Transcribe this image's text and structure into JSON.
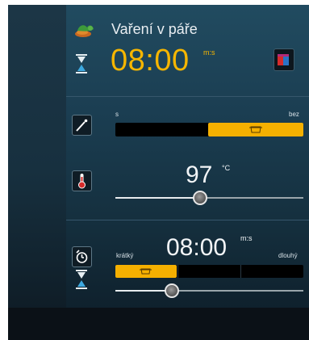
{
  "program": {
    "title": "Vaření v páře",
    "time": "08:00",
    "time_unit": "m:s"
  },
  "intensity": {
    "left_label": "s",
    "right_label": "bez",
    "selected_index": 1,
    "segment_count": 2
  },
  "temperature": {
    "value": "97",
    "unit": "°C",
    "slider_level": 0.45
  },
  "duration": {
    "value": "08:00",
    "unit": "m:s",
    "left_label": "krátký",
    "right_label": "dlouhý",
    "selected_index": 0,
    "segment_count": 3,
    "slider_level": 0.3
  },
  "icons": {
    "program": "vegetables-icon",
    "timer": "hourglass-icon",
    "favorite": "colored-tiles-icon",
    "wand": "magic-wand-icon",
    "thermometer": "thermometer-icon",
    "delay": "timer-clock-icon",
    "duration": "hourglass-icon",
    "pot": "pot-icon"
  },
  "colors": {
    "accent": "#f5b000",
    "panel": "#1b3e52"
  }
}
